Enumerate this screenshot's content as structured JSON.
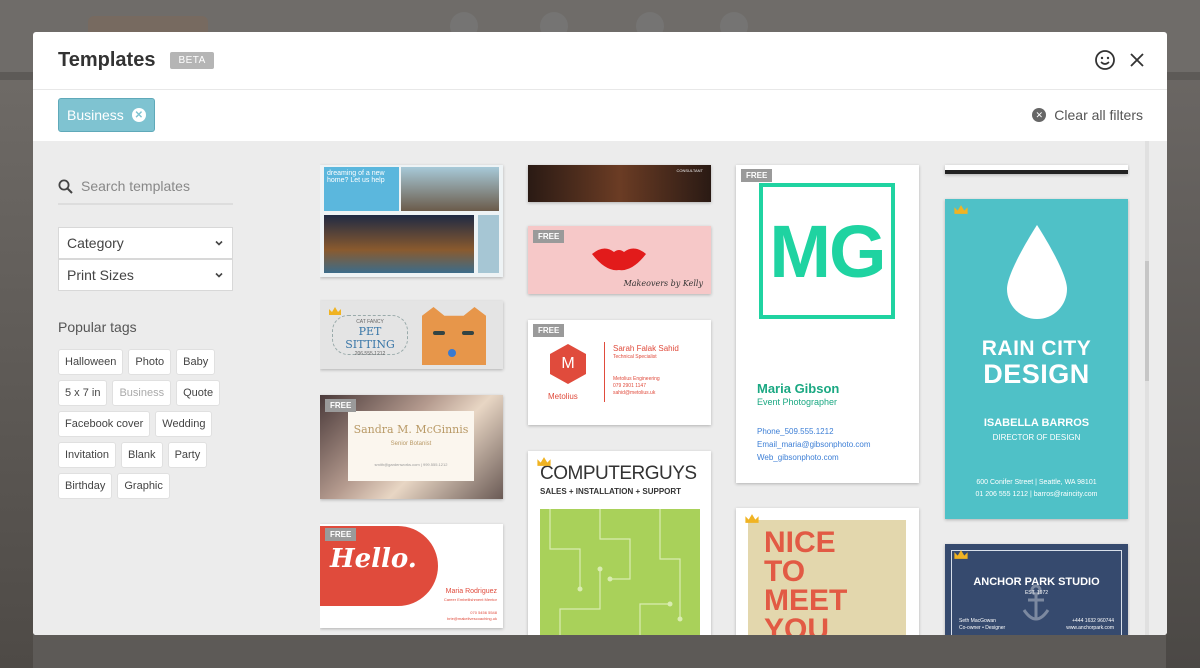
{
  "modal": {
    "title": "Templates",
    "badge": "BETA"
  },
  "filters": {
    "active_chip": "Business",
    "clear_label": "Clear all filters"
  },
  "sidebar": {
    "search_placeholder": "Search templates",
    "category_label": "Category",
    "print_sizes_label": "Print Sizes",
    "popular_tags_title": "Popular tags",
    "tags": [
      "Halloween",
      "Photo",
      "Baby",
      "5 x 7 in",
      "Business",
      "Quote",
      "Facebook cover",
      "Wedding",
      "Invitation",
      "Blank",
      "Party",
      "Birthday",
      "Graphic"
    ]
  },
  "templates": {
    "free_label": "FREE",
    "realestate": {
      "headline": "dreaming of a new home? Let us help"
    },
    "typewriter": {
      "text": "CONSULTANT"
    },
    "makeup": {
      "signature": "Makeovers by Kelly"
    },
    "petsitting": {
      "tagline": "CAT FANCY",
      "title": "PET SITTING",
      "phone": "206.555.1212"
    },
    "metolius": {
      "initial": "M",
      "brand": "Metolius",
      "name": "Sarah Falak Sahid",
      "role": "Technical Specialist",
      "company": "Metolius Engineering",
      "phone": "079 2901 1147",
      "email": "sahid@metolius.uk"
    },
    "botanist": {
      "name": "Sandra M. McGinnis",
      "role": "Senior Botanist",
      "contact": "smith@gardenworks.com | 999.555.1212"
    },
    "computerguys": {
      "brand": "COMPUTERGUYS",
      "sub": "SALES + INSTALLATION + SUPPORT"
    },
    "hello": {
      "bubble": "Hello.",
      "name": "Maria Rodriguez",
      "role": "Career Embellishment Mentor",
      "phone": "070 5456 5548",
      "email": "brie@makelivescoaching.uk"
    },
    "mg": {
      "monogram": "MG",
      "name": "Maria Gibson",
      "role": "Event Photographer",
      "phone": "Phone_509.555.1212",
      "email": "Email_maria@gibsonphoto.com",
      "web": "Web_gibsonphoto.com"
    },
    "nice": {
      "line1": "NICE",
      "line2": "TO",
      "line3": "MEET",
      "line4": "YOU"
    },
    "raincity": {
      "line1": "RAIN CITY",
      "line2": "DESIGN",
      "name": "ISABELLA BARROS",
      "role": "DIRECTOR OF DESIGN",
      "address": "600 Conifer Street | Seattle, WA 98101",
      "contact": "01 206 555 1212 | barros@raincity.com"
    },
    "anchor": {
      "title": "ANCHOR PARK STUDIO",
      "est": "EST. 1972",
      "name": "Seth MacGowan",
      "role": "Co-owner • Designer",
      "phone": "+444 1632 960744",
      "web": "www.anchorpark.com"
    }
  },
  "colors": {
    "accent_chip": "#7fc3d1",
    "mint": "#1fd3a1",
    "teal_card": "#4fc1c7",
    "coral": "#e04b3c"
  }
}
